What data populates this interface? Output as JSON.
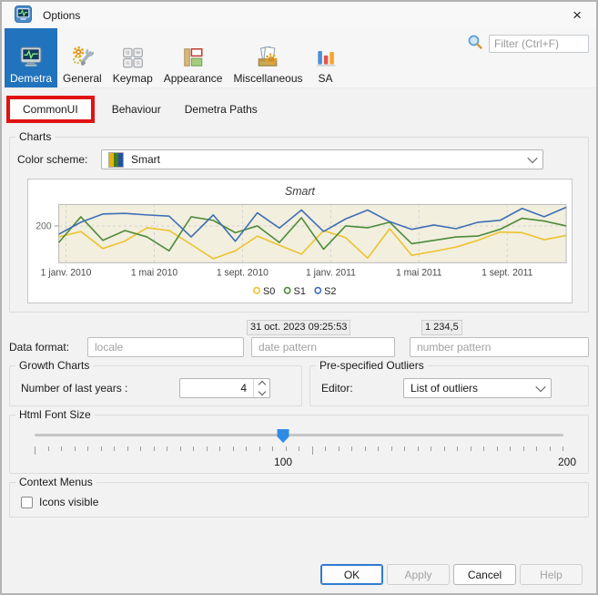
{
  "window": {
    "title": "Options"
  },
  "icons": {
    "close": "×"
  },
  "toolbar": {
    "categories": [
      {
        "label": "Demetra",
        "selected": true
      },
      {
        "label": "General",
        "selected": false
      },
      {
        "label": "Keymap",
        "selected": false
      },
      {
        "label": "Appearance",
        "selected": false
      },
      {
        "label": "Miscellaneous",
        "selected": false
      },
      {
        "label": "SA",
        "selected": false
      }
    ],
    "filter_placeholder": "Filter (Ctrl+F)"
  },
  "tabs": [
    {
      "label": "CommonUI",
      "selected": true,
      "annotated_red_box": true
    },
    {
      "label": "Behaviour",
      "selected": false
    },
    {
      "label": "Demetra Paths",
      "selected": false
    }
  ],
  "charts_group": {
    "title": "Charts",
    "color_scheme_label": "Color scheme:",
    "color_scheme_value": "Smart",
    "swatch_colors": [
      "#e9b400",
      "#3f7d1f",
      "#26519f"
    ]
  },
  "chart_data": {
    "type": "line",
    "title": "Smart",
    "x_start": "janv. 2010",
    "x_step": "1 month",
    "n_points": 24,
    "x_tick_labels": [
      "1 janv. 2010",
      "1 mai 2010",
      "1 sept. 2010",
      "1 janv. 2011",
      "1 mai 2011",
      "1 sept. 2011"
    ],
    "x_tick_month_indices": [
      0,
      4,
      8,
      12,
      16,
      20
    ],
    "y_tick_labels": [
      "200"
    ],
    "ylim": [
      80,
      270
    ],
    "grid": "dashed",
    "plot_bg": "#f2efdf",
    "legend_position": "bottom",
    "series": [
      {
        "name": "S0",
        "color": "#edc32f",
        "values": [
          164,
          182,
          126,
          151,
          194,
          185,
          140,
          93,
          119,
          167,
          137,
          108,
          185,
          162,
          95,
          191,
          104,
          117,
          131,
          153,
          180,
          178,
          155,
          169
        ]
      },
      {
        "name": "S1",
        "color": "#4e8b3a",
        "values": [
          146,
          230,
          153,
          185,
          164,
          119,
          230,
          218,
          178,
          200,
          146,
          227,
          124,
          200,
          194,
          212,
          142,
          153,
          164,
          167,
          189,
          225,
          216,
          200
        ]
      },
      {
        "name": "S2",
        "color": "#3f6fb4",
        "values": [
          173,
          212,
          239,
          241,
          236,
          232,
          164,
          236,
          150,
          243,
          193,
          252,
          182,
          223,
          252,
          214,
          189,
          203,
          191,
          212,
          218,
          257,
          230,
          261
        ]
      }
    ]
  },
  "data_format": {
    "label": "Data format:",
    "date_preview": "31 oct. 2023 09:25:53",
    "number_preview": "1 234,5",
    "locale_placeholder": "locale",
    "date_placeholder": "date pattern",
    "number_placeholder": "number pattern"
  },
  "growth_charts": {
    "title": "Growth Charts",
    "label": "Number of last years :",
    "value": "4"
  },
  "outliers": {
    "title": "Pre-specified Outliers",
    "label": "Editor:",
    "value": "List of outliers"
  },
  "font_size": {
    "title": "Html Font Size",
    "value": 100,
    "tick_labels": [
      "100",
      "200"
    ]
  },
  "context_menus": {
    "title": "Context Menus",
    "checkbox_label": "Icons visible",
    "checked": false
  },
  "buttons": [
    {
      "label": "OK",
      "primary": true,
      "disabled": false
    },
    {
      "label": "Apply",
      "primary": false,
      "disabled": true
    },
    {
      "label": "Cancel",
      "primary": false,
      "disabled": false
    },
    {
      "label": "Help",
      "primary": false,
      "disabled": true
    }
  ],
  "colors": {
    "selected_category_bg": "#2273bd",
    "annotation_red": "#e01212",
    "primary_button_border": "#2e7bd2",
    "slider_thumb": "#2f8be4"
  }
}
